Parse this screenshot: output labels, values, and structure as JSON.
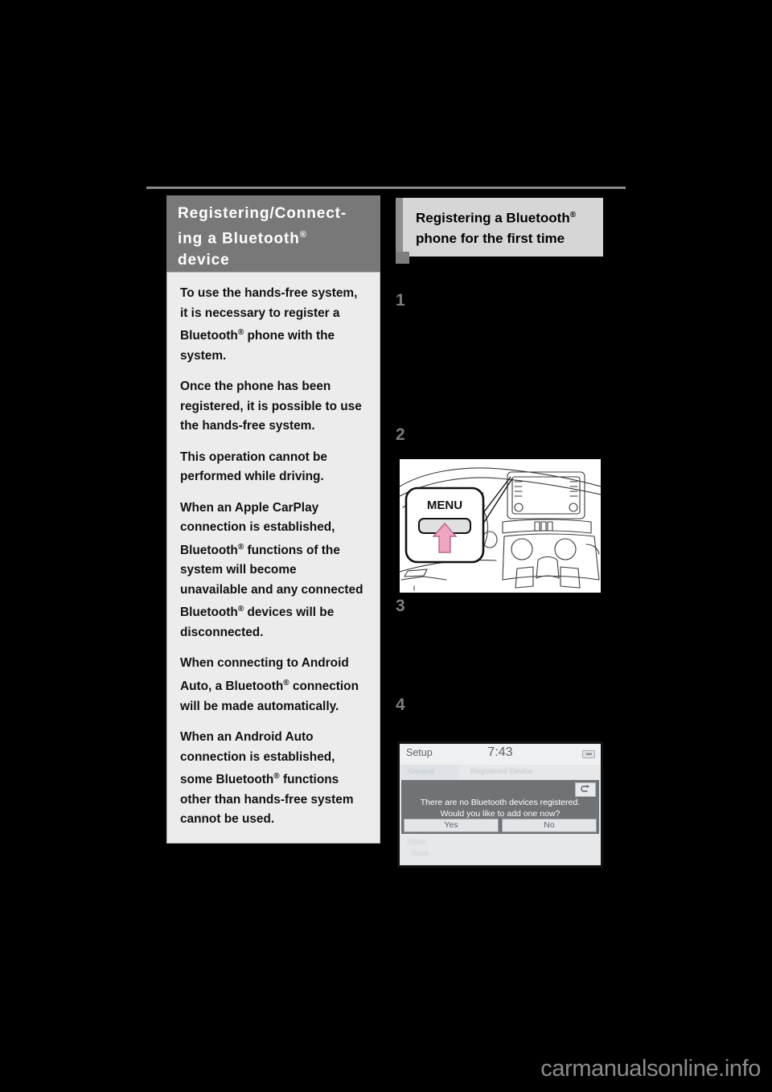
{
  "page": {
    "watermark": "carmanualsonline.info"
  },
  "left_column": {
    "header": {
      "line1": "Registering/Connect-",
      "line2": "ing a Bluetooth",
      "registered_mark": "®",
      "line3": "device"
    },
    "info_box": {
      "paragraphs": [
        {
          "part1": "To use the hands-free sys-tem, it is necessary to regis-ter a Bluetooth",
          "mark": "®",
          "part2": " phone with the system.",
          "text": "To use the hands-free system, it is necessary to register a Bluetooth® phone with the system."
        },
        {
          "text": "Once the phone has been registered, it is possible to use the hands-free system."
        },
        {
          "text": "This operation cannot be performed while driving."
        },
        {
          "part1": "When an Apple CarPlay connection is established, Bluetooth",
          "mark": "®",
          "part2": " functions of the system will become unavailable and any connected Bluetooth",
          "mark2": "®",
          "part3": " devices will be disconnected."
        },
        {
          "part1": "When connecting to Android Auto, a Bluetooth",
          "mark": "®",
          "part2": " connection will be made automatically."
        },
        {
          "part1": "When an Android Auto connection is established, some Bluetooth",
          "mark": "®",
          "part2": " functions other than hands-free system cannot be used."
        }
      ]
    }
  },
  "right_column": {
    "header": {
      "line1": "Registering a Bluetooth",
      "registered_mark": "®",
      "line2": "phone for the first time"
    },
    "steps": [
      {
        "number": "1"
      },
      {
        "number": "2"
      },
      {
        "number": "3"
      },
      {
        "number": "4"
      }
    ],
    "figure_menu": {
      "button_label": "MENU",
      "arrow_color": "#e9a0bc"
    },
    "figure_screen": {
      "title": "Setup",
      "clock": "7:43",
      "status_icon": "signal-icon",
      "tabs": [
        {
          "label": "General"
        },
        {
          "label": "Registered Device"
        }
      ],
      "dialog": {
        "message_line1": "There are no Bluetooth devices registered.",
        "message_line2": "Would you like to add one now?",
        "back_icon": "return-arrow-icon",
        "buttons": [
          {
            "label": "Yes"
          },
          {
            "label": "No"
          }
        ]
      },
      "faded_items": [
        {
          "label": "Clock"
        },
        {
          "label": "Voice"
        }
      ]
    }
  }
}
